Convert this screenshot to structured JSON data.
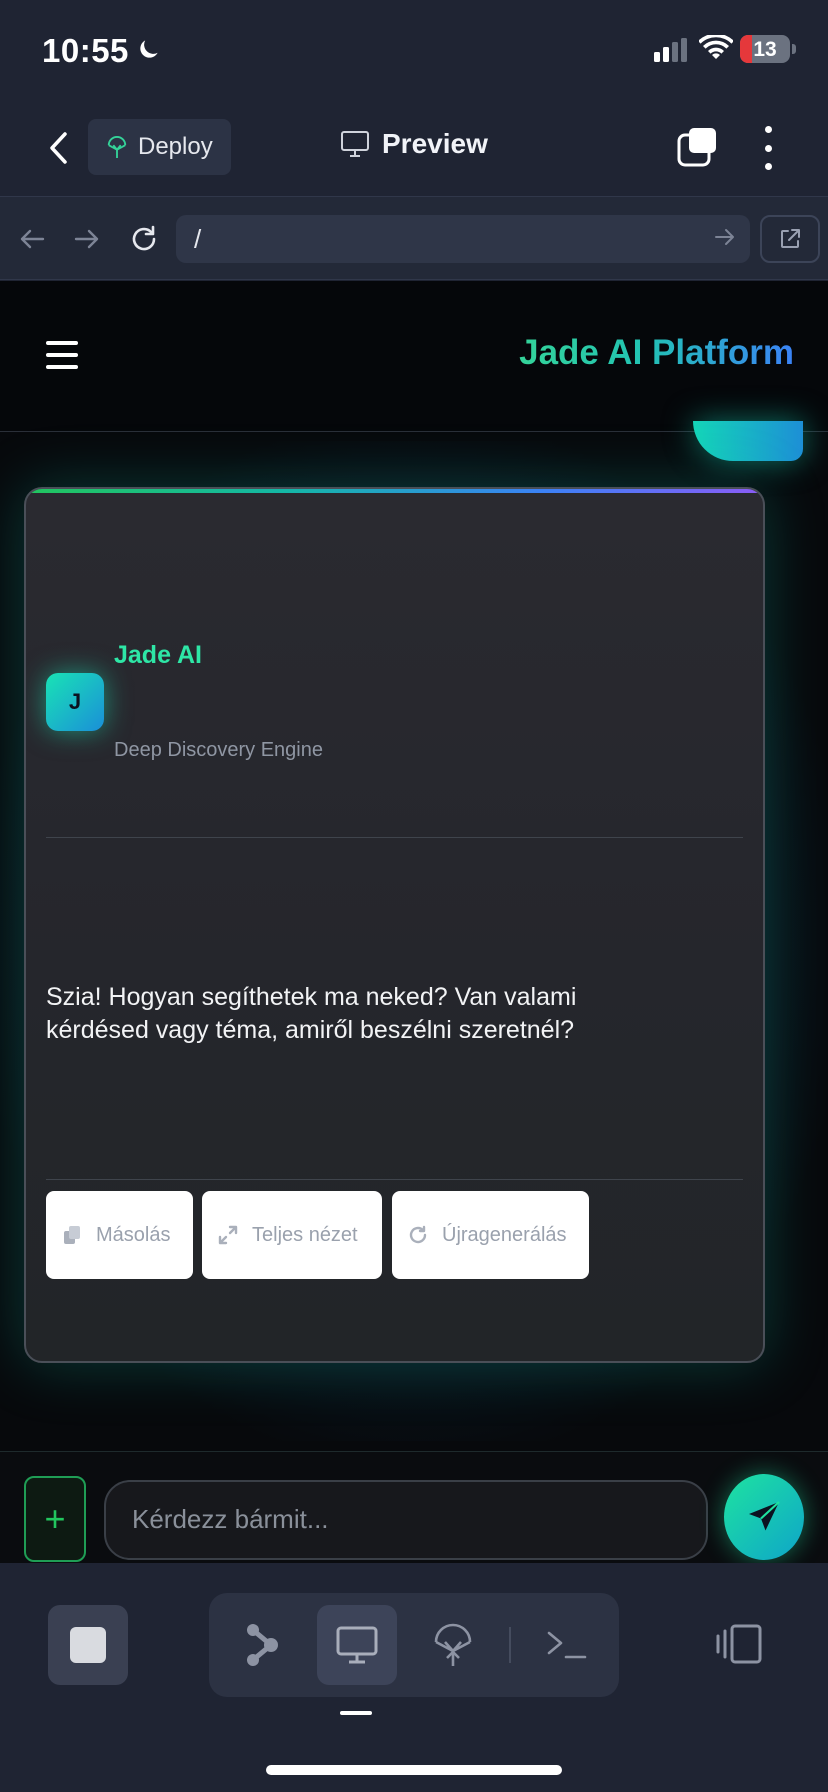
{
  "status_bar": {
    "time": "10:55",
    "battery": "13"
  },
  "nav": {
    "deploy_label": "Deploy",
    "title": "Preview"
  },
  "url_bar": {
    "url": "/"
  },
  "web": {
    "brand": "Jade AI Platform",
    "card": {
      "avatar_letter": "J",
      "bot_name": "Jade AI",
      "bot_subtitle": "Deep Discovery Engine",
      "message": "Szia! Hogyan segíthetek ma neked? Van valami kérdésed vagy téma, amiről beszélni szeretnél?",
      "actions": [
        {
          "label": "Másolás",
          "icon": "copy-icon"
        },
        {
          "label": "Teljes nézet",
          "icon": "expand-icon"
        },
        {
          "label": "Újragenerálás",
          "icon": "refresh-icon"
        }
      ]
    },
    "composer": {
      "placeholder": "Kérdezz bármit...",
      "add_label": "+"
    }
  },
  "toolbar": {
    "items": [
      "stop-icon",
      "nodes-icon",
      "monitor-icon",
      "deploy-icon",
      "terminal-icon",
      "panel-icon"
    ],
    "active": "monitor-icon"
  },
  "colors": {
    "accent_green": "#2ee6a6",
    "accent_blue": "#3b82f6",
    "app_bg": "#1f2433"
  }
}
